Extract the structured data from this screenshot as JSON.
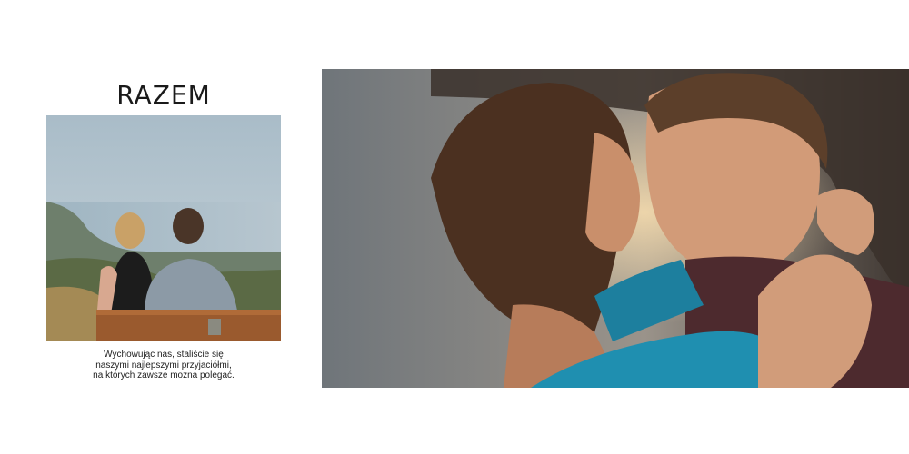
{
  "spread": {
    "title": "RAZEM",
    "caption_lines": [
      "Wychowując nas, staliście się",
      "naszymi najlepszymi przyjaciółmi,",
      "na których zawsze można polegać."
    ]
  },
  "photos": {
    "small": {
      "subject": "couple-on-bench-overlooking-coast"
    },
    "large": {
      "subject": "couple-embracing-at-sunset"
    }
  },
  "colors": {
    "page_background": "#ffffff",
    "text": "#1a1a1a"
  }
}
